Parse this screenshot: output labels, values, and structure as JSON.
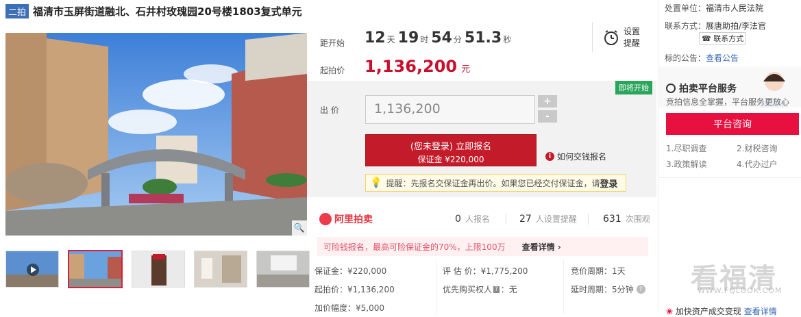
{
  "title": {
    "badge": "二拍",
    "text": "福清市玉屏街道融北、石井村玫瑰园20号楼1803复式单元"
  },
  "timer": {
    "label": "距开始",
    "days": "12",
    "days_unit": "天",
    "hours": "19",
    "hours_unit": "时",
    "minutes": "54",
    "minutes_unit": "分",
    "seconds": "51.3",
    "seconds_unit": "秒"
  },
  "start_price": {
    "label": "起拍价",
    "value": "1,136,200",
    "unit": "元"
  },
  "remind": {
    "line1": "设置",
    "line2": "提醒",
    "icon": "alarm-clock-icon"
  },
  "bid": {
    "status_badge": "即将开始",
    "label": "出 价",
    "input_value": "1,136,200",
    "plus": "+",
    "minus": "-",
    "signup_main": "(您未登录) 立即报名",
    "signup_sub": "保证金 ¥220,000",
    "how_to": "如何交钱报名",
    "tip_text": "提醒：先报名交保证金再出价。如果您已经交付保证金，请",
    "tip_login": "登录"
  },
  "platform": {
    "logo_text": "阿里拍卖",
    "signups_count": "0",
    "signups_label": "人报名",
    "reminders_count": "27",
    "reminders_label": "人设置提醒",
    "views_count": "631",
    "views_label": "次围观"
  },
  "refund": {
    "text": "可险钱报名，最高可险保证金的70%，上限100万",
    "link": "查看详情 ›"
  },
  "details": {
    "deposit": "保证金：¥220,000",
    "start_price": "起拍价：¥1,136,200",
    "increment": "加价幅度：¥5,000",
    "appraisal": "评 估 价：¥1,775,200",
    "priority": "优先购买权人",
    "priority_value": "：无",
    "period": "竞价周期：1天",
    "delay": "延时周期：5分钟"
  },
  "right": {
    "court_label": "处置单位：",
    "court_value": "福清市人民法院",
    "contact_label": "联系方式：",
    "contact_value": "展唐助拍/李法官",
    "contact_btn": "联系方式",
    "notice_label": "标的公告：",
    "notice_link": "查看公告",
    "service_title": "拍卖平台服务",
    "service_sub": "竞拍信息全掌握，平台服务更放心",
    "consult_btn": "平台咨询",
    "items": [
      "1.尽职调查",
      "2.财税咨询",
      "3.政策解读",
      "4.代办过户"
    ],
    "bottom": "加快资产成交变现",
    "bottom_link": "查看详情"
  },
  "watermark": {
    "text": "看福清",
    "url": "WWW.FQLOOK.COM"
  }
}
